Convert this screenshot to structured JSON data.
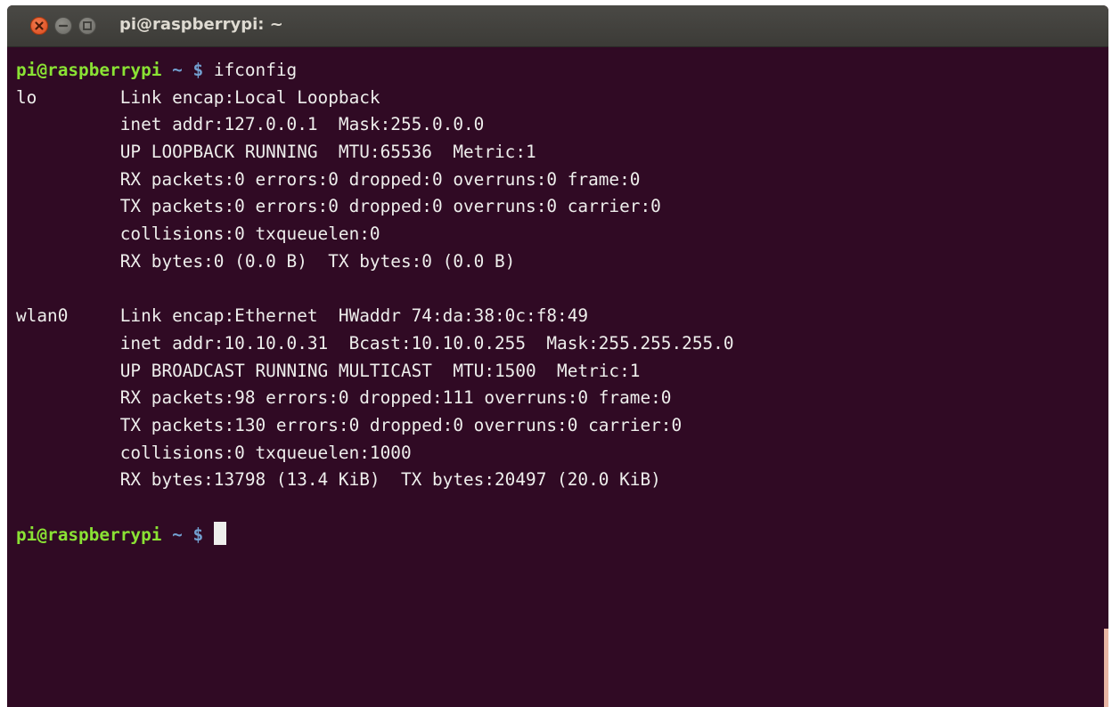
{
  "window": {
    "title": "pi@raspberrypi: ~"
  },
  "terminal": {
    "prompt_user_host": "pi@raspberrypi",
    "prompt_path": " ~ $",
    "command": " ifconfig",
    "output": [
      "lo        Link encap:Local Loopback",
      "          inet addr:127.0.0.1  Mask:255.0.0.0",
      "          UP LOOPBACK RUNNING  MTU:65536  Metric:1",
      "          RX packets:0 errors:0 dropped:0 overruns:0 frame:0",
      "          TX packets:0 errors:0 dropped:0 overruns:0 carrier:0",
      "          collisions:0 txqueuelen:0",
      "          RX bytes:0 (0.0 B)  TX bytes:0 (0.0 B)",
      "",
      "wlan0     Link encap:Ethernet  HWaddr 74:da:38:0c:f8:49",
      "          inet addr:10.10.0.31  Bcast:10.10.0.255  Mask:255.255.255.0",
      "          UP BROADCAST RUNNING MULTICAST  MTU:1500  Metric:1",
      "          RX packets:98 errors:0 dropped:111 overruns:0 frame:0",
      "          TX packets:130 errors:0 dropped:0 overruns:0 carrier:0",
      "          collisions:0 txqueuelen:1000",
      "          RX bytes:13798 (13.4 KiB)  TX bytes:20497 (20.0 KiB)",
      ""
    ]
  },
  "colors": {
    "terminal_background": "#300a24",
    "terminal_text": "#eeeeec",
    "prompt_user": "#8ae234",
    "prompt_path": "#729fcf",
    "close_button": "#e05a2a"
  },
  "icons": {
    "close": "close-icon",
    "minimize": "minimize-icon",
    "maximize": "maximize-icon"
  }
}
